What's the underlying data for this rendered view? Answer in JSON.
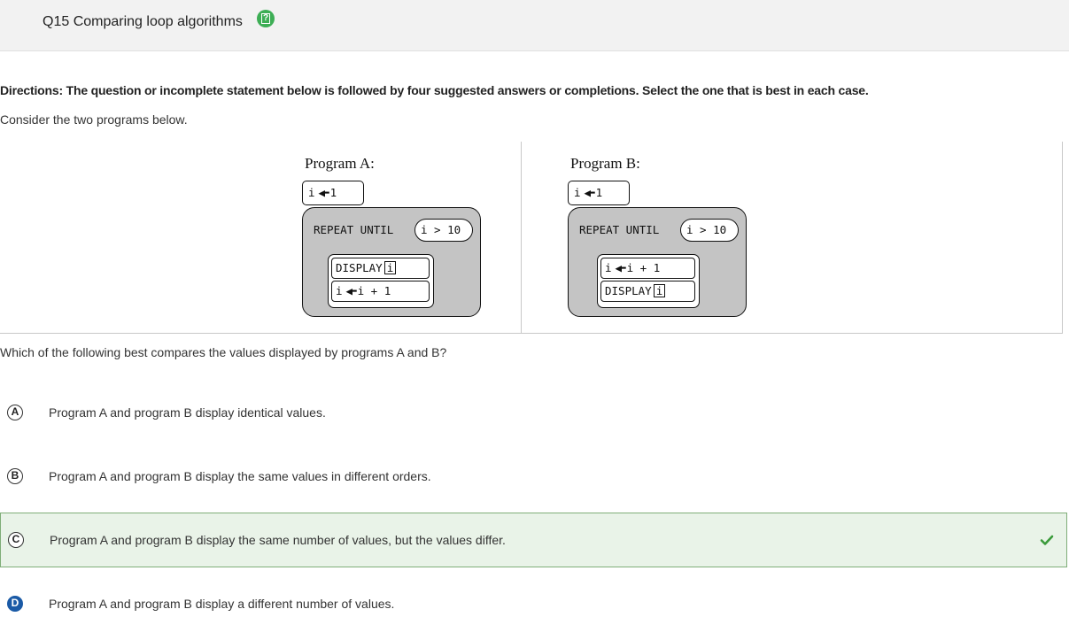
{
  "header": {
    "title": "Q15 Comparing loop algorithms",
    "help_icon_glyph": "?"
  },
  "directions": "Directions: The question or incomplete statement below is followed by four suggested answers or completions. Select the one that is best in each case.",
  "intro": "Consider the two programs below.",
  "programs": {
    "a": {
      "label": "Program A:",
      "init_var": "i",
      "init_val": "1",
      "repeat_label": "REPEAT UNTIL",
      "condition": "i > 10",
      "stmt1_kw": "DISPLAY",
      "stmt1_var": "i",
      "stmt2": "i",
      "stmt2_expr": "i + 1"
    },
    "b": {
      "label": "Program B:",
      "init_var": "i",
      "init_val": "1",
      "repeat_label": "REPEAT UNTIL",
      "condition": "i > 10",
      "stmt1": "i",
      "stmt1_expr": "i + 1",
      "stmt2_kw": "DISPLAY",
      "stmt2_var": "i"
    }
  },
  "question": "Which of the following best compares the values displayed by programs A and B?",
  "options": [
    {
      "letter": "A",
      "text": "Program A and program B display identical values."
    },
    {
      "letter": "B",
      "text": "Program A and program B display the same values in different orders."
    },
    {
      "letter": "C",
      "text": "Program A and program B display the same number of values, but the values differ."
    },
    {
      "letter": "D",
      "text": "Program A and program B display a different number of values."
    }
  ],
  "colors": {
    "correct_bg": "#e9f3e8",
    "correct_border": "#7fae78",
    "check": "#3a9a3a",
    "selected_letter": "#1a5aa6",
    "help_icon": "#3dae55"
  }
}
